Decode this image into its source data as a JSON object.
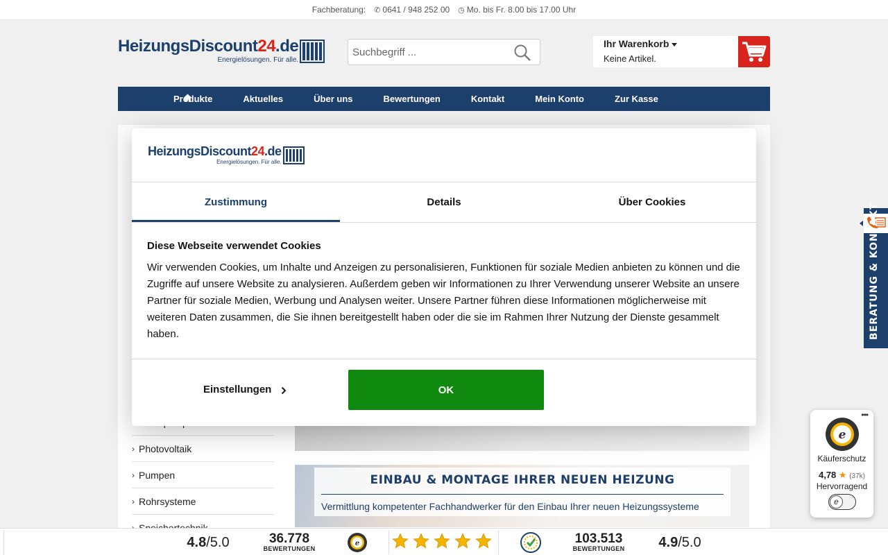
{
  "topbar": {
    "label": "Fachberatung:",
    "phone": "0641 / 948 252 00",
    "hours": "Mo. bis Fr. 8.00 bis 17.00 Uhr"
  },
  "logo": {
    "brand_a": "HeizungsDiscount",
    "brand_b": "24",
    "brand_c": ".de",
    "tagline": "Energielösungen. Für alle."
  },
  "search": {
    "placeholder": "Suchbegriff ..."
  },
  "cart": {
    "title": "Ihr Warenkorb",
    "status": "Keine Artikel."
  },
  "nav": {
    "items": [
      "Produkte",
      "Aktuelles",
      "Über uns",
      "Bewertungen",
      "Kontakt",
      "Mein Konto",
      "Zur Kasse"
    ]
  },
  "sidebar": {
    "items": [
      "...rmepumpen",
      "Photovoltaik",
      "Pumpen",
      "Rohrsysteme",
      "Speichertechnik"
    ]
  },
  "banner": {
    "title": "EINBAU & MONTAGE IHRER NEUEN HEIZUNG",
    "subtitle": "Vermittlung kompetenter Fachhandwerker für den Einbau Ihrer neuen Heizungssysteme"
  },
  "cookie_dialog": {
    "tabs": [
      "Zustimmung",
      "Details",
      "Über Cookies"
    ],
    "title": "Diese Webseite verwendet Cookies",
    "text": "Wir verwenden Cookies, um Inhalte und Anzeigen zu personalisieren, Funktionen für soziale Medien anbieten zu können und die Zugriffe auf unsere Website zu analysieren. Außerdem geben wir Informationen zu Ihrer Verwendung unserer Website an unsere Partner für soziale Medien, Werbung und Analysen weiter. Unsere Partner führen diese Informationen möglicherweise mit weiteren Daten zusammen, die Sie ihnen bereitgestellt haben oder die sie im Rahmen Ihrer Nutzung der Dienste gesammelt haben.",
    "settings_label": "Einstellungen",
    "ok_label": "OK"
  },
  "side_contact": {
    "label": "BERATUNG & KONTAKT"
  },
  "trusted_shops": {
    "label": "Käuferschutz",
    "score": "4,78",
    "count": "(37k)",
    "rating_word": "Hervorragend"
  },
  "ratings_bar": {
    "left_score": "4.8",
    "left_max": "/5.0",
    "left_count": "36.778",
    "left_caption": "BEWERTUNGEN",
    "right_count": "103.513",
    "right_caption": "BEWERTUNGEN",
    "right_score": "4.9",
    "right_max": "/5.0"
  },
  "colors": {
    "brand_blue": "#1d3f6b",
    "brand_red": "#d9241d",
    "ok_green": "#0f8a0f",
    "star_gold": "#f5b400"
  }
}
